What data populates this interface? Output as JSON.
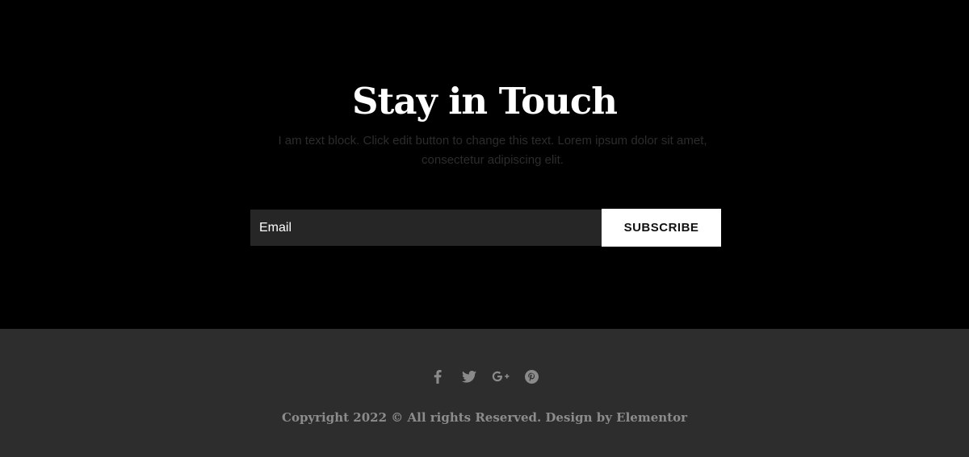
{
  "newsletter": {
    "title": "Stay in Touch",
    "description": "I am text block. Click edit button to change this text. Lorem ipsum dolor sit amet, consectetur adipiscing elit.",
    "email_placeholder": "Email",
    "email_value": "",
    "subscribe_label": "SUBSCRIBE"
  },
  "footer": {
    "social_icons": [
      "facebook-icon",
      "twitter-icon",
      "google-plus-icon",
      "pinterest-icon"
    ],
    "copyright": "Copyright 2022 © All rights Reserved. Design by Elementor"
  },
  "colors": {
    "background": "#000000",
    "footer_background": "#2d2d2d",
    "input_background": "#262626",
    "button_background": "#ffffff",
    "icon_color": "#8a8a8a",
    "copyright_color": "#8c8c8c"
  }
}
